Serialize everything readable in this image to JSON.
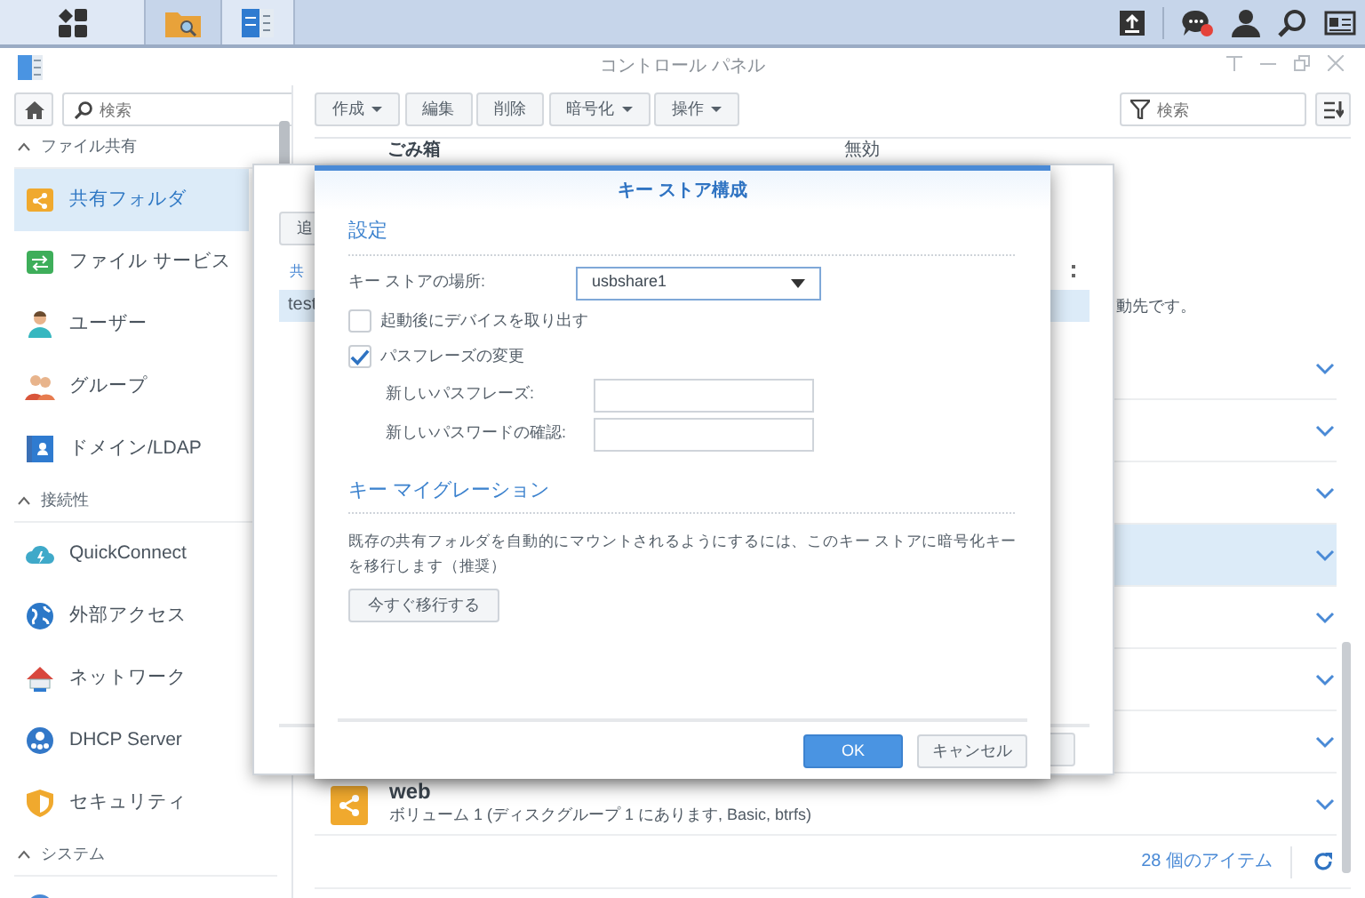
{
  "window": {
    "title": "コントロール パネル"
  },
  "sidebar": {
    "search_placeholder": "検索",
    "sections": [
      {
        "title": "ファイル共有",
        "expanded": true,
        "items": [
          {
            "label": "共有フォルダ",
            "kind": "share-folder",
            "selected": true
          },
          {
            "label": "ファイル サービス",
            "kind": "file-services",
            "selected": false
          },
          {
            "label": "ユーザー",
            "kind": "user",
            "selected": false
          },
          {
            "label": "グループ",
            "kind": "group",
            "selected": false
          },
          {
            "label": "ドメイン/LDAP",
            "kind": "domain",
            "selected": false
          }
        ]
      },
      {
        "title": "接続性",
        "expanded": true,
        "items": [
          {
            "label": "QuickConnect",
            "kind": "cloud",
            "selected": false
          },
          {
            "label": "外部アクセス",
            "kind": "globe",
            "selected": false
          },
          {
            "label": "ネットワーク",
            "kind": "house",
            "selected": false
          },
          {
            "label": "DHCP Server",
            "kind": "dhcp",
            "selected": false
          },
          {
            "label": "セキュリティ",
            "kind": "shield",
            "selected": false
          }
        ]
      },
      {
        "title": "システム",
        "expanded": true
      }
    ]
  },
  "toolbar": {
    "buttons": [
      {
        "label": "作成",
        "dropdown": true
      },
      {
        "label": "編集",
        "dropdown": false
      },
      {
        "label": "削除",
        "dropdown": false
      },
      {
        "label": "暗号化",
        "dropdown": true
      },
      {
        "label": "操作",
        "dropdown": true
      }
    ],
    "filter_placeholder": "検索"
  },
  "detail": {
    "label": "ごみ箱",
    "value": "無効",
    "tail": "動先です。"
  },
  "rows": [
    {
      "selected": false
    },
    {
      "selected": false
    },
    {
      "selected": false
    },
    {
      "selected": true
    },
    {
      "selected": false
    },
    {
      "selected": false
    },
    {
      "selected": false
    },
    {
      "name": "web",
      "description": "ボリューム 1 (ディスクグループ 1 にあります, Basic, btrfs)",
      "selected": false
    }
  ],
  "footer": {
    "count": "28 個のアイテム"
  },
  "background_window": {
    "button": "追",
    "column": "共",
    "row": {
      "name": "test",
      "selected": true
    }
  },
  "dialog": {
    "title": "キー ストア構成",
    "settings_heading": "設定",
    "key_store_label": "キー ストアの場所:",
    "key_store_value": "usbshare1",
    "options": [
      {
        "label": "起動後にデバイスを取り出す",
        "checked": false
      },
      {
        "label": "パスフレーズの変更",
        "checked": true
      }
    ],
    "fields": [
      {
        "label": "新しいパスフレーズ:"
      },
      {
        "label": "新しいパスワードの確認:"
      }
    ],
    "migration_heading": "キー マイグレーション",
    "migration_text": "既存の共有フォルダを自動的にマウントされるようにするには、このキー ストアに暗号化キーを移行します（推奨）",
    "migrate_button": "今すぐ移行する",
    "buttons": [
      {
        "label": "OK",
        "kind": "primary"
      },
      {
        "label": "キャンセル",
        "kind": "secondary"
      }
    ]
  }
}
